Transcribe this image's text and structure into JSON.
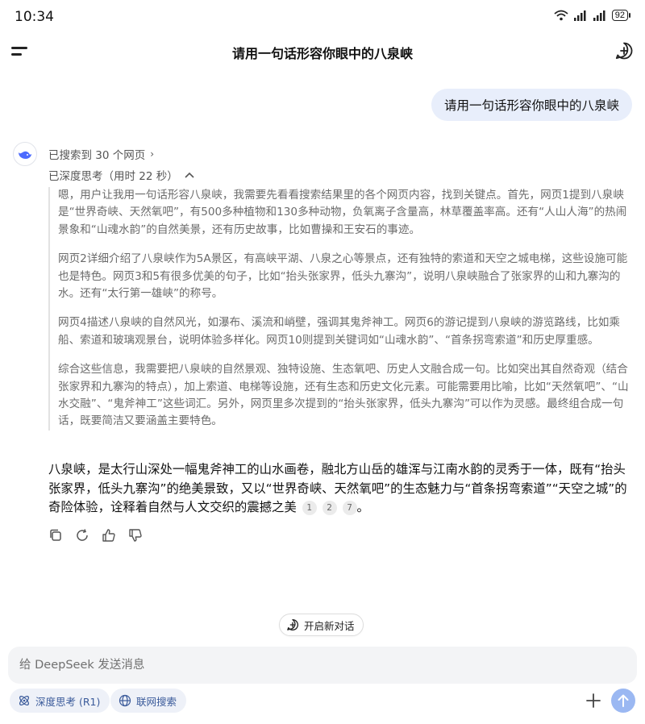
{
  "status_bar": {
    "time": "10:34",
    "battery": "92"
  },
  "header": {
    "title": "请用一句话形容你眼中的八泉峡"
  },
  "user_message": "请用一句话形容你眼中的八泉峡",
  "assistant": {
    "search_label": "已搜索到 30 个网页",
    "think_label": "已深度思考（用时 22 秒）",
    "thinking": [
      "嗯，用户让我用一句话形容八泉峡，我需要先看看搜索结果里的各个网页内容，找到关键点。首先，网页1提到八泉峡是“世界奇峡、天然氧吧”，有500多种植物和130多种动物，负氧离子含量高，林草覆盖率高。还有“人山人海”的热闹景象和“山魂水韵”的自然美景，还有历史故事，比如曹操和王安石的事迹。",
      "网页2详细介绍了八泉峡作为5A景区，有高峡平湖、八泉之心等景点，还有独特的索道和天空之城电梯，这些设施可能也是特色。网页3和5有很多优美的句子，比如“抬头张家界，低头九寨沟”，说明八泉峡融合了张家界的山和九寨沟的水。还有“太行第一雄峡”的称号。",
      "网页4描述八泉峡的自然风光，如瀑布、溪流和峭壁，强调其鬼斧神工。网页6的游记提到八泉峡的游览路线，比如乘船、索道和玻璃观景台，说明体验多样化。网页10则提到关键词如“山魂水韵”、“首条拐弯索道”和历史厚重感。",
      "综合这些信息，我需要把八泉峡的自然景观、独特设施、生态氧吧、历史人文融合成一句。比如突出其自然奇观（结合张家界和九寨沟的特点），加上索道、电梯等设施，还有生态和历史文化元素。可能需要用比喻，比如“天然氧吧”、“山水交融”、“鬼斧神工”这些词汇。另外，网页里多次提到的“抬头张家界，低头九寨沟”可以作为灵感。最终组合成一句话，既要简洁又要涵盖主要特色。"
    ],
    "answer": "八泉峡，是太行山深处一幅鬼斧神工的山水画卷，融北方山岳的雄浑与江南水韵的灵秀于一体，既有“抬头张家界，低头九寨沟”的绝美景致，又以“世界奇峡、天然氧吧”的生态魅力与“首条拐弯索道”“天空之城”的奇险体验，诠释着自然与人文交织的震撼之美",
    "citations": [
      "1",
      "2",
      "7"
    ],
    "answer_end": "。"
  },
  "new_chat_label": "开启新对话",
  "composer": {
    "placeholder": "给 DeepSeek 发送消息"
  },
  "chips": {
    "deep_think": "深度思考 (R1)",
    "web_search": "联网搜索"
  },
  "colors": {
    "accent": "#4d6bfe",
    "send": "#9bb8f2",
    "user_bubble": "#e8eefb"
  }
}
